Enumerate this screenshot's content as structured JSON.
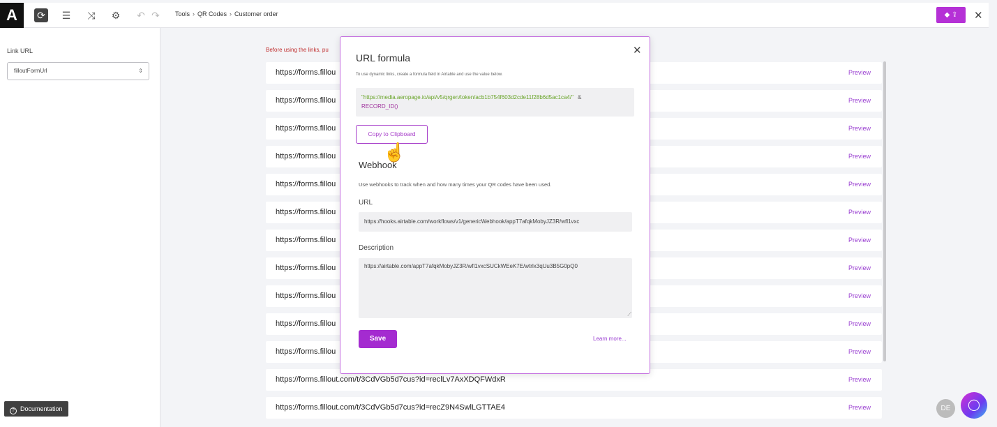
{
  "topbar": {
    "logo": "A",
    "icons": [
      "refresh-icon",
      "database-icon",
      "shuffle-icon",
      "gear-icon",
      "undo-icon",
      "redo-icon"
    ],
    "breadcrumb": [
      "Tools",
      "QR Codes",
      "Customer order"
    ],
    "close": "✕"
  },
  "sidebar": {
    "link_url_label": "Link URL",
    "link_url_value": "filloutFormUrl",
    "documentation_label": "Documentation"
  },
  "main": {
    "warning": "Before using the links, pu",
    "rows": [
      {
        "url": "https://forms.fillou",
        "preview": "Preview"
      },
      {
        "url": "https://forms.fillou",
        "preview": "Preview"
      },
      {
        "url": "https://forms.fillou",
        "preview": "Preview"
      },
      {
        "url": "https://forms.fillou",
        "preview": "Preview"
      },
      {
        "url": "https://forms.fillou",
        "preview": "Preview"
      },
      {
        "url": "https://forms.fillou",
        "preview": "Preview"
      },
      {
        "url": "https://forms.fillou",
        "preview": "Preview"
      },
      {
        "url": "https://forms.fillou",
        "preview": "Preview"
      },
      {
        "url": "https://forms.fillou",
        "preview": "Preview"
      },
      {
        "url": "https://forms.fillou",
        "preview": "Preview"
      },
      {
        "url": "https://forms.fillou",
        "preview": "Preview"
      },
      {
        "url": "https://forms.fillout.com/t/3CdVGb5d7cus?id=reclLv7AxXDQFWdxR",
        "preview": "Preview"
      },
      {
        "url": "https://forms.fillout.com/t/3CdVGb5d7cus?id=recZ9N4SwlLGTTAE4",
        "preview": "Preview"
      }
    ],
    "avatar": "DE"
  },
  "modal": {
    "title": "URL formula",
    "help": "To use dynamic links, create a formula field in Airtable and use the value below.",
    "formula_string": "\"https://media.aeropage.io/api/v5/qrgen/token/acb1b754f603d2cde11f28b6d5ac1ca4/\"",
    "formula_amp": "&",
    "formula_fn": "RECORD_ID()",
    "copy_label": "Copy to Clipboard",
    "webhook_title": "Webhook",
    "webhook_help": "Use webhooks to track when and how many times your QR codes have been used.",
    "url_label": "URL",
    "url_value": "https://hooks.airtable.com/workflows/v1/genericWebhook/appT7afqkMobyJZ3R/wfl1vxc",
    "description_label": "Description",
    "description_value": "https://airtable.com/appT7afqkMobyJZ3R/wfl1vxcSUCkWEeK7E/wtrlx3qUu3B5G0pQ0",
    "save_label": "Save",
    "learn_more": "Learn more..."
  },
  "colors": {
    "accent": "#a42bd0",
    "warning": "#c03030",
    "link": "#9a3fd1",
    "formula_string": "#6aa52b"
  }
}
